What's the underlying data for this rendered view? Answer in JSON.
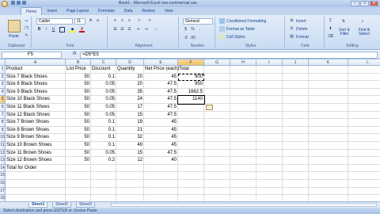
{
  "window": {
    "title": "Book1 - Microsoft Excel non-commercial use",
    "controls": [
      "–",
      "□",
      "✕"
    ]
  },
  "ribbon_tabs": [
    "Home",
    "Insert",
    "Page Layout",
    "Formulas",
    "Data",
    "Review",
    "View"
  ],
  "ribbon": {
    "clipboard": {
      "paste": "Paste",
      "label": "Clipboard"
    },
    "font": {
      "name": "Calibri",
      "size": "11",
      "label": "Font",
      "bold": "B",
      "italic": "I",
      "underline": "U"
    },
    "alignment": {
      "label": "Alignment"
    },
    "number": {
      "format": "General",
      "label": "Number",
      "currency": "$",
      "percent": "%"
    },
    "styles": {
      "conditional": "Conditional Formatting",
      "table": "Format as Table",
      "cell": "Cell Styles",
      "label": "Styles"
    },
    "cells": {
      "insert": "Insert",
      "delete": "Delete",
      "format": "Format",
      "label": "Cells"
    },
    "editing": {
      "sort": "Sort & Filter",
      "find": "Find & Select",
      "label": "Editing",
      "sigma": "Σ"
    }
  },
  "formula_bar": {
    "name_box": "F5",
    "fx": "fx",
    "formula": "=D5*E5"
  },
  "columns": [
    "A",
    "B",
    "C",
    "D",
    "E",
    "F",
    "G",
    "H",
    "I",
    "J",
    "K",
    "L"
  ],
  "rows": [
    [
      "Product",
      "List Price",
      "Discount",
      "Quantity",
      "Net Price (each)",
      "Total"
    ],
    [
      "Size 7 Black Shoes",
      "50",
      "0.1",
      "20",
      "45",
      "900"
    ],
    [
      "Size 8 Black Shoes",
      "50",
      "0.05",
      "20",
      "47.5",
      "950"
    ],
    [
      "Size 9 Black Shoes",
      "50",
      "0.05",
      "35",
      "47.5",
      "1662.5"
    ],
    [
      "Size 10 Black Shoes",
      "50",
      "0.05",
      "24",
      "47.5",
      "1140"
    ],
    [
      "Size 11 Black Shoes",
      "50",
      "0.05",
      "17",
      "47.5",
      ""
    ],
    [
      "Size 12 Black Shoes",
      "50",
      "0.05",
      "15",
      "47.5",
      ""
    ],
    [
      "Size 7 Brown Shoes",
      "50",
      "0.1",
      "19",
      "45",
      ""
    ],
    [
      "Size 8 Brown Shoes",
      "50",
      "0.1",
      "21",
      "45",
      ""
    ],
    [
      "Size 9 Brown Shoes",
      "50",
      "0.1",
      "32",
      "45",
      ""
    ],
    [
      "Size 10 Brown Shoes",
      "50",
      "0.1",
      "49",
      "45",
      ""
    ],
    [
      "Size 11 Brown Shoes",
      "50",
      "0.05",
      "15",
      "47.5",
      ""
    ],
    [
      "Size 12 Brown Shoes",
      "50",
      "0.2",
      "12",
      "40",
      ""
    ],
    [
      "    Total for Order",
      "",
      "",
      "",
      "",
      ""
    ],
    [
      "",
      "",
      "",
      "",
      "",
      ""
    ],
    [
      "",
      "",
      "",
      "",
      "",
      ""
    ],
    [
      "",
      "",
      "",
      "",
      "",
      ""
    ],
    [
      "",
      "",
      "",
      "",
      "",
      ""
    ]
  ],
  "sheets": [
    "Sheet1",
    "Sheet2",
    "Sheet3"
  ],
  "status": "Select destination and press ENTER or choose Paste"
}
